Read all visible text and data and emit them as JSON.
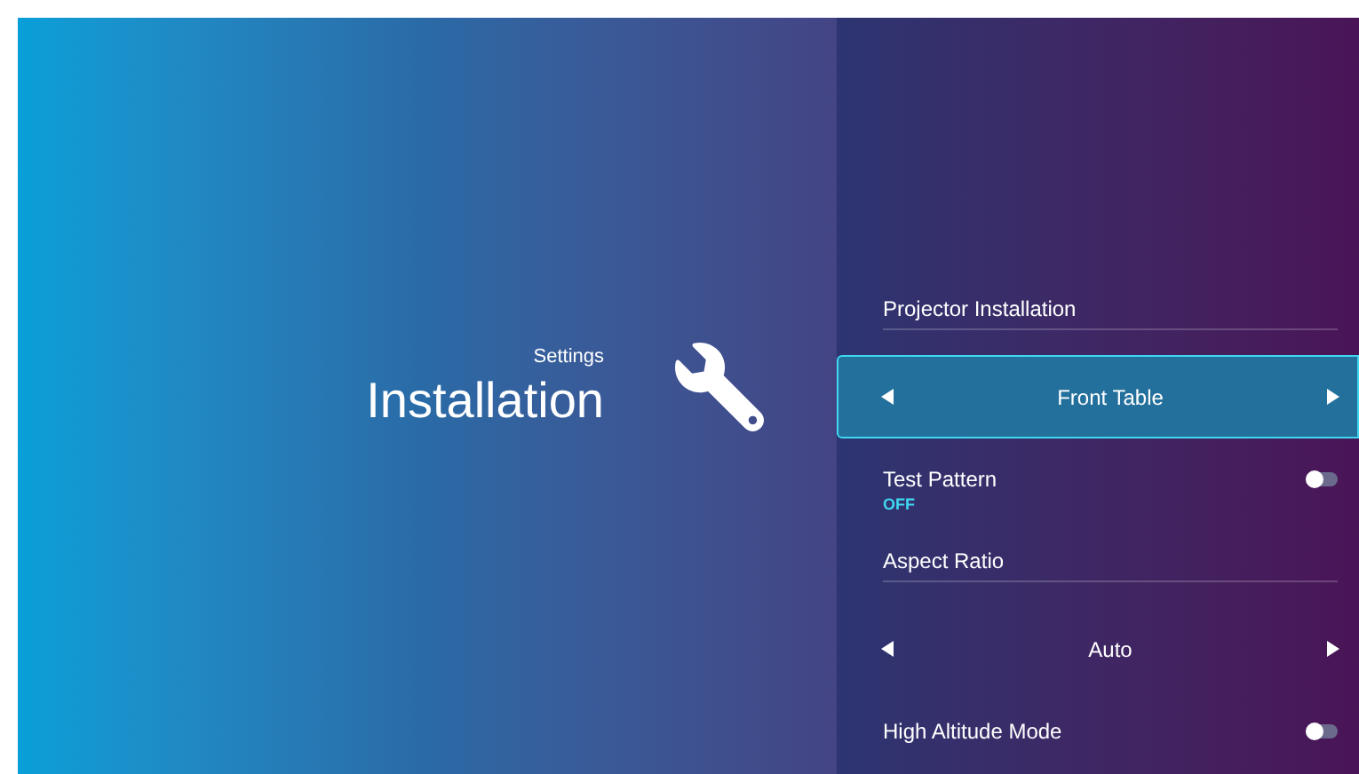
{
  "header": {
    "breadcrumb": "Settings",
    "title": "Installation"
  },
  "items": [
    {
      "kind": "header",
      "label": "Projector Installation"
    },
    {
      "kind": "selector",
      "value": "Front Table",
      "selected": true
    },
    {
      "kind": "toggle",
      "label": "Test Pattern",
      "status": "OFF",
      "on": false
    },
    {
      "kind": "header",
      "label": "Aspect Ratio"
    },
    {
      "kind": "selector",
      "value": "Auto",
      "selected": false
    },
    {
      "kind": "toggle",
      "label": "High Altitude Mode",
      "on": false
    }
  ]
}
